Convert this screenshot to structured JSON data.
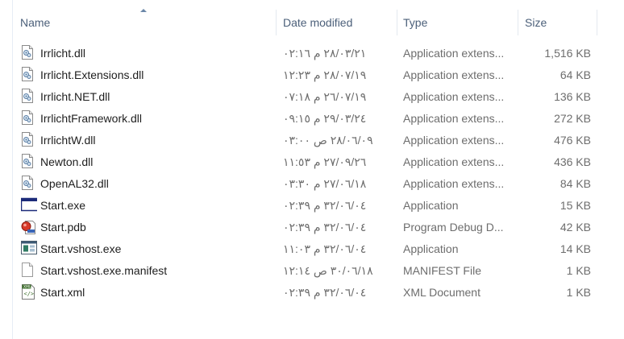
{
  "columns": {
    "name": "Name",
    "date": "Date modified",
    "type": "Type",
    "size": "Size"
  },
  "files": [
    {
      "name": "Irrlicht.dll",
      "date": "٢٨/٠٣/٢١ م ٠٢:١٦",
      "type": "Application extens...",
      "size": "1,516 KB",
      "icon": "dll-icon"
    },
    {
      "name": "Irrlicht.Extensions.dll",
      "date": "٢٨/٠٧/١٩ م ١٢:٢٣",
      "type": "Application extens...",
      "size": "64 KB",
      "icon": "dll-icon"
    },
    {
      "name": "Irrlicht.NET.dll",
      "date": "٢٦/٠٧/١٩ م ٠٧:١٨",
      "type": "Application extens...",
      "size": "136 KB",
      "icon": "dll-icon"
    },
    {
      "name": "IrrlichtFramework.dll",
      "date": "٢٩/٠٣/٢٤ م ٠٩:١٥",
      "type": "Application extens...",
      "size": "272 KB",
      "icon": "dll-icon"
    },
    {
      "name": "IrrlichtW.dll",
      "date": "٢٨/٠٦/٠٩ ص ٠٣:٠٠",
      "type": "Application extens...",
      "size": "476 KB",
      "icon": "dll-icon"
    },
    {
      "name": "Newton.dll",
      "date": "٢٧/٠٩/٢٦ م ١١:٥٣",
      "type": "Application extens...",
      "size": "436 KB",
      "icon": "dll-icon"
    },
    {
      "name": "OpenAL32.dll",
      "date": "٢٧/٠٦/١٨ م ٠٣:٣٠",
      "type": "Application extens...",
      "size": "84 KB",
      "icon": "dll-icon"
    },
    {
      "name": "Start.exe",
      "date": "٣٢/٠٦/٠٤ م ٠٢:٣٩",
      "type": "Application",
      "size": "15 KB",
      "icon": "exe-icon"
    },
    {
      "name": "Start.pdb",
      "date": "٣٢/٠٦/٠٤ م ٠٢:٣٩",
      "type": "Program Debug D...",
      "size": "42 KB",
      "icon": "pdb-icon"
    },
    {
      "name": "Start.vshost.exe",
      "date": "٣٢/٠٦/٠٤ م ١١:٠٣",
      "type": "Application",
      "size": "14 KB",
      "icon": "vshost-exe-icon"
    },
    {
      "name": "Start.vshost.exe.manifest",
      "date": "٣٠/٠٦/١٨ ص ١٢:١٤",
      "type": "MANIFEST File",
      "size": "1 KB",
      "icon": "manifest-file-icon"
    },
    {
      "name": "Start.xml",
      "date": "٣٢/٠٦/٠٤ م ٠٢:٣٩",
      "type": "XML Document",
      "size": "1 KB",
      "icon": "xml-icon"
    }
  ],
  "colors": {
    "header_text": "#4c607a",
    "name_text": "#1e1e1e",
    "detail_text": "#6d6d6d"
  }
}
